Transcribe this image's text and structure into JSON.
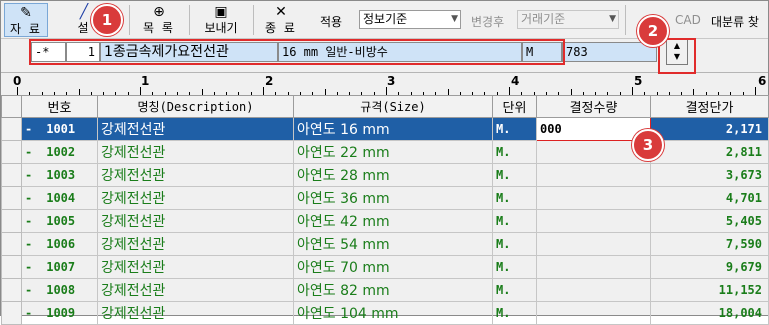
{
  "toolbar": {
    "btn_data": "자 료",
    "btn_setting_partial": "설",
    "btn_list": "목 록",
    "btn_send": "보내기",
    "btn_exit": "종 료",
    "apply_label": "적용",
    "apply_value": "정보기준",
    "after_change_label": "변경후",
    "after_change_value": "거래기준",
    "cad_partial": "CAD",
    "category_partial": "대분류 찾"
  },
  "info_bar": {
    "prefix": "-*",
    "index": "1",
    "name": "1종금속제가요전선관",
    "spec": "16 mm 일반-비방수",
    "unit": "M",
    "code": "783"
  },
  "ruler": {
    "labels": [
      "0",
      "1",
      "2",
      "3",
      "4",
      "5",
      "6"
    ]
  },
  "table": {
    "headers": {
      "no": "번호",
      "name": "명칭(Description)",
      "spec": "규격(Size)",
      "unit": "단위",
      "qty": "결정수량",
      "price": "결정단가"
    },
    "rows": [
      {
        "mark": "-",
        "no": "1001",
        "name": "강제전선관",
        "spec": "아연도 16 mm",
        "unit": "M.",
        "qty": "000",
        "price": "2,171"
      },
      {
        "mark": "-",
        "no": "1002",
        "name": "강제전선관",
        "spec": "아연도 22 mm",
        "unit": "M.",
        "qty": "",
        "price": "2,811"
      },
      {
        "mark": "-",
        "no": "1003",
        "name": "강제전선관",
        "spec": "아연도 28 mm",
        "unit": "M.",
        "qty": "",
        "price": "3,673"
      },
      {
        "mark": "-",
        "no": "1004",
        "name": "강제전선관",
        "spec": "아연도 36 mm",
        "unit": "M.",
        "qty": "",
        "price": "4,701"
      },
      {
        "mark": "-",
        "no": "1005",
        "name": "강제전선관",
        "spec": "아연도 42 mm",
        "unit": "M.",
        "qty": "",
        "price": "5,405"
      },
      {
        "mark": "-",
        "no": "1006",
        "name": "강제전선관",
        "spec": "아연도 54 mm",
        "unit": "M.",
        "qty": "",
        "price": "7,590"
      },
      {
        "mark": "-",
        "no": "1007",
        "name": "강제전선관",
        "spec": "아연도 70 mm",
        "unit": "M.",
        "qty": "",
        "price": "9,679"
      },
      {
        "mark": "-",
        "no": "1008",
        "name": "강제전선관",
        "spec": "아연도 82 mm",
        "unit": "M.",
        "qty": "",
        "price": "11,152"
      },
      {
        "mark": "-",
        "no": "1009",
        "name": "강제전선관",
        "spec": "아연도 104 mm",
        "unit": "M.",
        "qty": "",
        "price": "18,004"
      }
    ]
  },
  "callouts": {
    "one": "1",
    "two": "2",
    "three": "3"
  },
  "colors": {
    "selection": "#1f5fa6",
    "row_text": "#1a7d1a",
    "callout": "#d93b3b"
  }
}
